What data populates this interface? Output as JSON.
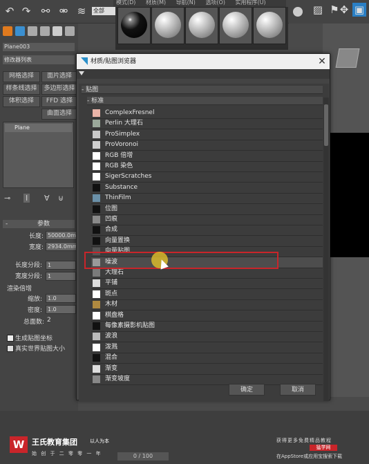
{
  "menubar": {
    "items": [
      "模式(D)",
      "材质(M)",
      "导航(N)",
      "选项(O)",
      "实用程序(U)"
    ]
  },
  "toolbar": {
    "filter_dropdown": "全部"
  },
  "left_panel": {
    "object_name": "Plane003",
    "modifier_list": "修改器列表",
    "buttons": [
      "网格选择",
      "面片选择",
      "样条线选择",
      "多边形选择",
      "体积选择",
      "FFD 选择",
      "曲面选择"
    ],
    "stack_item": "Plane",
    "params_header": "参数",
    "length_label": "长度:",
    "length_value": "50000.0m",
    "width_label": "宽度:",
    "width_value": "2934.0mm",
    "length_segs_label": "长度分段:",
    "length_segs_value": "1",
    "width_segs_label": "宽度分段:",
    "width_segs_value": "1",
    "render_mult_header": "渲染倍增",
    "scale_label": "缩放:",
    "scale_value": "1.0",
    "density_label": "密度:",
    "density_value": "1.0",
    "total_faces_label": "总面数:",
    "total_faces_value": "2",
    "gen_mapping": "生成贴图坐标",
    "real_world": "真实世界贴图大小"
  },
  "dialog": {
    "title": "材质/贴图浏览器",
    "group_maps": "- 贴图",
    "group_standard": "- 标准",
    "items": [
      {
        "label": "ComplexFresnel",
        "color": "#e9b4a8"
      },
      {
        "label": "Perlin 大理石",
        "color": "#9aa89a"
      },
      {
        "label": "ProSimplex",
        "color": "#c8c8c8"
      },
      {
        "label": "ProVoronoi",
        "color": "#d0d0d0"
      },
      {
        "label": "RGB 倍增",
        "color": "#ffffff"
      },
      {
        "label": "RGB 染色",
        "color": "#ffffff"
      },
      {
        "label": "SigerScratches",
        "color": "#ffffff"
      },
      {
        "label": "Substance",
        "color": "#111111"
      },
      {
        "label": "ThinFilm",
        "color": "#6a90a8"
      },
      {
        "label": "位图",
        "color": "#111111"
      },
      {
        "label": "凹痕",
        "color": "#8a8a8a"
      },
      {
        "label": "合成",
        "color": "#111111"
      },
      {
        "label": "向量置换",
        "color": "#111111"
      },
      {
        "label": "向量贴图",
        "color": "#555555"
      },
      {
        "label": "噪波",
        "color": "#9a9a9a"
      },
      {
        "label": "大理石",
        "color": "#7a7a7a"
      },
      {
        "label": "平铺",
        "color": "#dcdcdc"
      },
      {
        "label": "斑点",
        "color": "#ffffff"
      },
      {
        "label": "木材",
        "color": "#b08a40"
      },
      {
        "label": "棋盘格",
        "color": "#ffffff"
      },
      {
        "label": "每像素摄影机贴图",
        "color": "#111111"
      },
      {
        "label": "波浪",
        "color": "#bbbbbb"
      },
      {
        "label": "泼溅",
        "color": "#ffffff"
      },
      {
        "label": "混合",
        "color": "#111111"
      },
      {
        "label": "渐变",
        "color": "#dddddd"
      },
      {
        "label": "渐变坡度",
        "color": "#888888"
      }
    ],
    "ok_label": "确定",
    "cancel_label": "取消"
  },
  "timeline": {
    "frame": "0 / 100"
  },
  "watermark": {
    "logo_char": "W",
    "brand_name": "王氏教育集团",
    "tag": "以人为本",
    "slogan": "始 创 于 二 零 零 一 年",
    "promo": "获得更多免费精品教程",
    "badge": "猛学网",
    "store_note": "在AppStore或应用宝搜索下载"
  }
}
